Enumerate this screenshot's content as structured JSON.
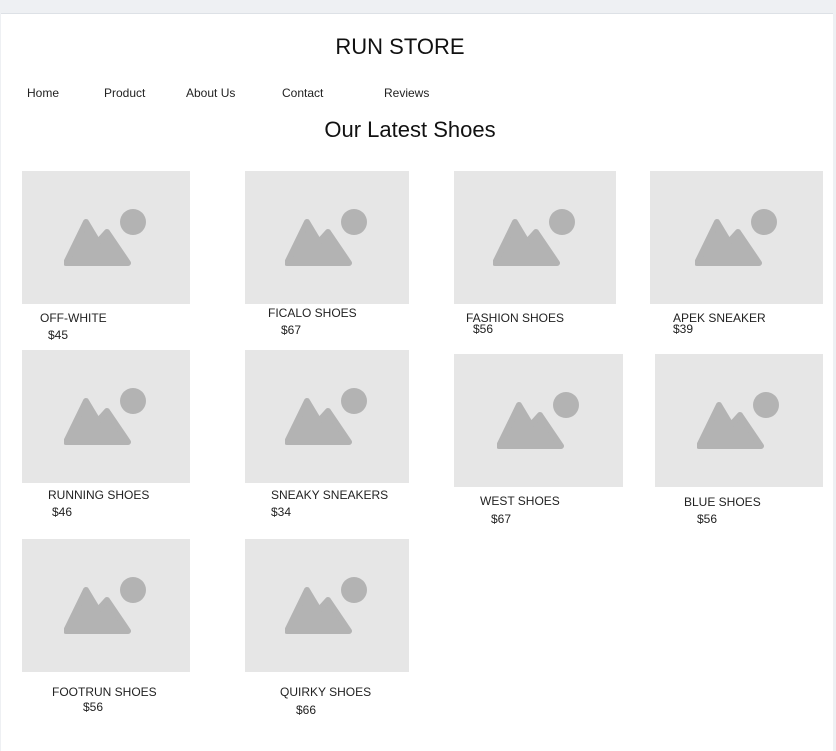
{
  "site": {
    "title": "RUN STORE"
  },
  "nav": {
    "items": [
      "Home",
      "Product",
      "About Us",
      "Contact",
      "Reviews"
    ]
  },
  "section": {
    "title": "Our Latest Shoes"
  },
  "products": [
    {
      "name": "OFF-WHITE",
      "price": "$45",
      "image_icon": "image-placeholder-icon"
    },
    {
      "name": "FICALO SHOES",
      "price": "$67",
      "image_icon": "image-placeholder-icon"
    },
    {
      "name": "FASHION SHOES",
      "price": "$56",
      "image_icon": "image-placeholder-icon"
    },
    {
      "name": "APEK SNEAKER",
      "price": "$39",
      "image_icon": "image-placeholder-icon"
    },
    {
      "name": "RUNNING SHOES",
      "price": "$46",
      "image_icon": "image-placeholder-icon"
    },
    {
      "name": "SNEAKY SNEAKERS",
      "price": "$34",
      "image_icon": "image-placeholder-icon"
    },
    {
      "name": "WEST SHOES",
      "price": "$67",
      "image_icon": "image-placeholder-icon"
    },
    {
      "name": "BLUE SHOES",
      "price": "$56",
      "image_icon": "image-placeholder-icon"
    },
    {
      "name": "FOOTRUN SHOES",
      "price": "$56",
      "image_icon": "image-placeholder-icon"
    },
    {
      "name": "QUIRKY SHOES",
      "price": "$66",
      "image_icon": "image-placeholder-icon"
    }
  ],
  "colors": {
    "placeholder_bg": "#e6e6e6",
    "placeholder_glyph": "#b3b3b3",
    "page_bg": "#ffffff"
  }
}
